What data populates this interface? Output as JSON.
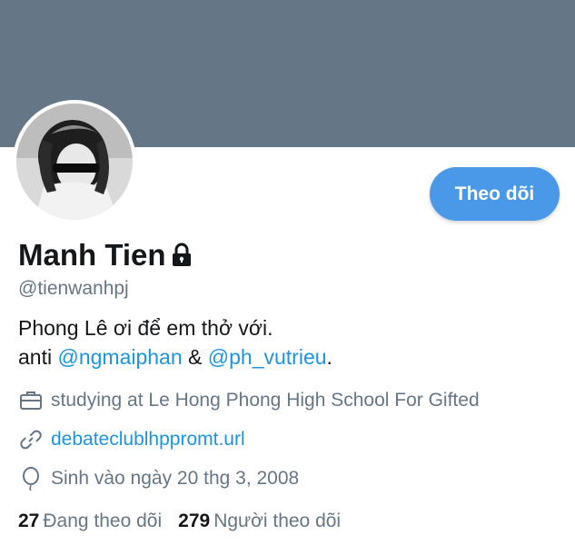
{
  "profile": {
    "name": "Manh Tien",
    "handle": "@tienwanhpj",
    "follow_label": "Theo dõi",
    "bio_line1": "Phong Lê ơi để em thở với.",
    "bio_line2_prefix": "anti ",
    "mention1": "@ngmaiphan",
    "bio_amp": " & ",
    "mention2": "@ph_vutrieu",
    "bio_end": ".",
    "work": "studying at Le Hong Phong High School For Gifted",
    "link": "debateclublhppromt.url",
    "birthday": "Sinh vào ngày 20 thg 3, 2008",
    "following_count": "27",
    "following_label": "Đang theo dõi",
    "followers_count": "279",
    "followers_label": "Người theo dõi"
  },
  "colors": {
    "banner": "#657786",
    "accent": "#4a99e9",
    "link": "#1b95e0",
    "muted": "#657786"
  },
  "icons": [
    "lock-icon",
    "briefcase-icon",
    "link-icon",
    "balloon-icon"
  ]
}
